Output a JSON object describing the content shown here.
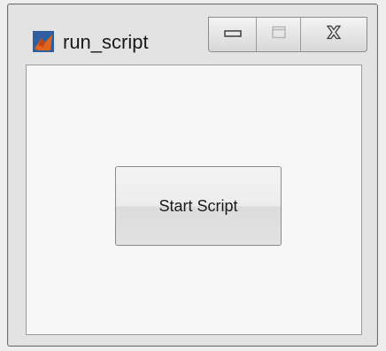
{
  "window": {
    "title": "run_script",
    "app_icon": "matlab-icon",
    "caption_buttons": {
      "minimize_icon": "minimize-icon",
      "maximize_icon": "maximize-icon",
      "close_icon": "close-icon"
    }
  },
  "main": {
    "start_button_label": "Start Script"
  },
  "colors": {
    "window_frame": "#e3e3e3",
    "client_background": "#f7f7f7",
    "button_border": "#8a8a8a",
    "icon_orange": "#e0641e",
    "icon_blue": "#2f5f9e"
  }
}
